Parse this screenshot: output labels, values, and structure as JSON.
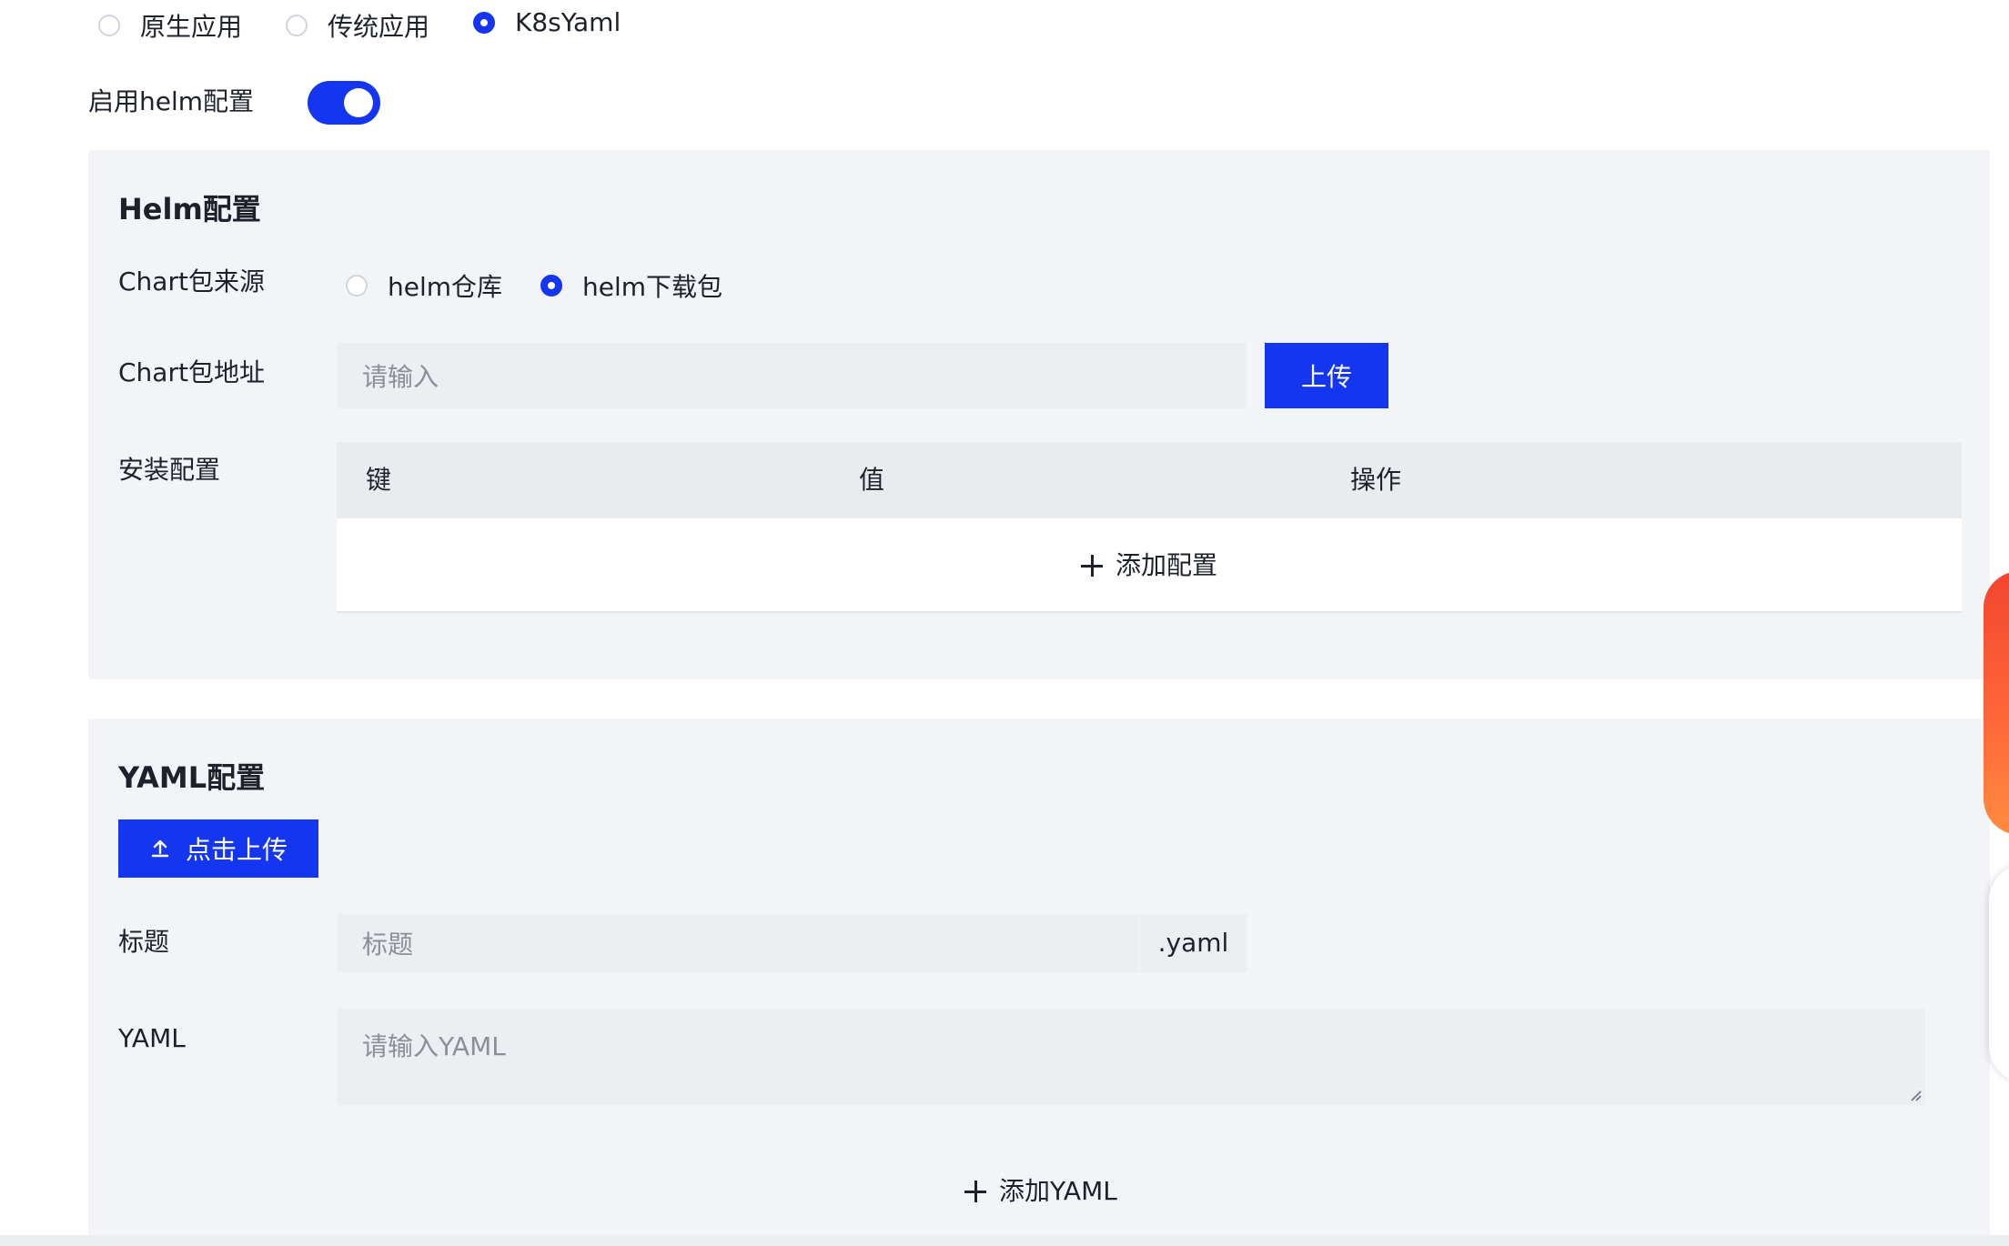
{
  "app_type": {
    "options": [
      "原生应用",
      "传统应用",
      "K8sYaml"
    ],
    "selected": "K8sYaml"
  },
  "helm_toggle": {
    "label": "启用helm配置",
    "enabled": true
  },
  "helm_section": {
    "title": "Helm配置",
    "chart_source": {
      "label": "Chart包来源",
      "options": [
        "helm仓库",
        "helm下载包"
      ],
      "selected": "helm下载包"
    },
    "chart_address": {
      "label": "Chart包地址",
      "placeholder": "请输入",
      "upload_button": "上传"
    },
    "install_config": {
      "label": "安装配置",
      "columns": [
        "键",
        "值",
        "操作"
      ],
      "add_label": "添加配置"
    }
  },
  "yaml_section": {
    "title": "YAML配置",
    "upload_button": "点击上传",
    "title_field": {
      "label": "标题",
      "placeholder": "标题",
      "suffix": ".yaml"
    },
    "yaml_field": {
      "label": "YAML",
      "placeholder": "请输入YAML"
    },
    "add_label": "添加YAML"
  },
  "colors": {
    "primary": "#1436f0",
    "panel_bg": "#f3f4f8",
    "input_bg": "#eceef2"
  }
}
